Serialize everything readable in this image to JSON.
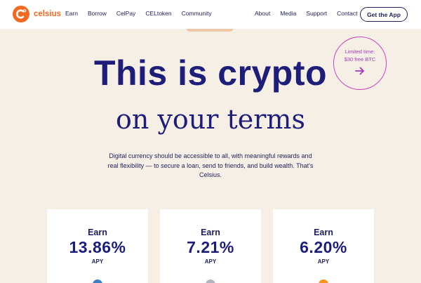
{
  "brand": {
    "name": "celsius",
    "color": "#f26a21"
  },
  "nav": {
    "left": [
      "Earn",
      "Borrow",
      "CelPay",
      "CELtoken",
      "Community"
    ],
    "right": [
      "About",
      "Media",
      "Support",
      "Contact"
    ],
    "cta": "Get the App"
  },
  "hero": {
    "title": "This is crypto",
    "subtitle": "on your terms",
    "description": "Digital currency should be accessible to all, with meaningful rewards and real flexibility — to secure a loan, send to friends, and build wealth. That's Celsius."
  },
  "badge": {
    "line1": "Limited time:",
    "line2": "$30 free BTC",
    "icon": "arrow-right-icon"
  },
  "cards": [
    {
      "label": "Earn",
      "rate": "13.86%",
      "unit": "APY",
      "coin_color": "#3b7fc4"
    },
    {
      "label": "Earn",
      "rate": "7.21%",
      "unit": "APY",
      "coin_color": "#b0b5c0"
    },
    {
      "label": "Earn",
      "rate": "6.20%",
      "unit": "APY",
      "coin_color": "#f7931a"
    }
  ],
  "colors": {
    "navy": "#1d1e7a",
    "background": "#f6efe6",
    "accent_pink": "#c846c0"
  }
}
